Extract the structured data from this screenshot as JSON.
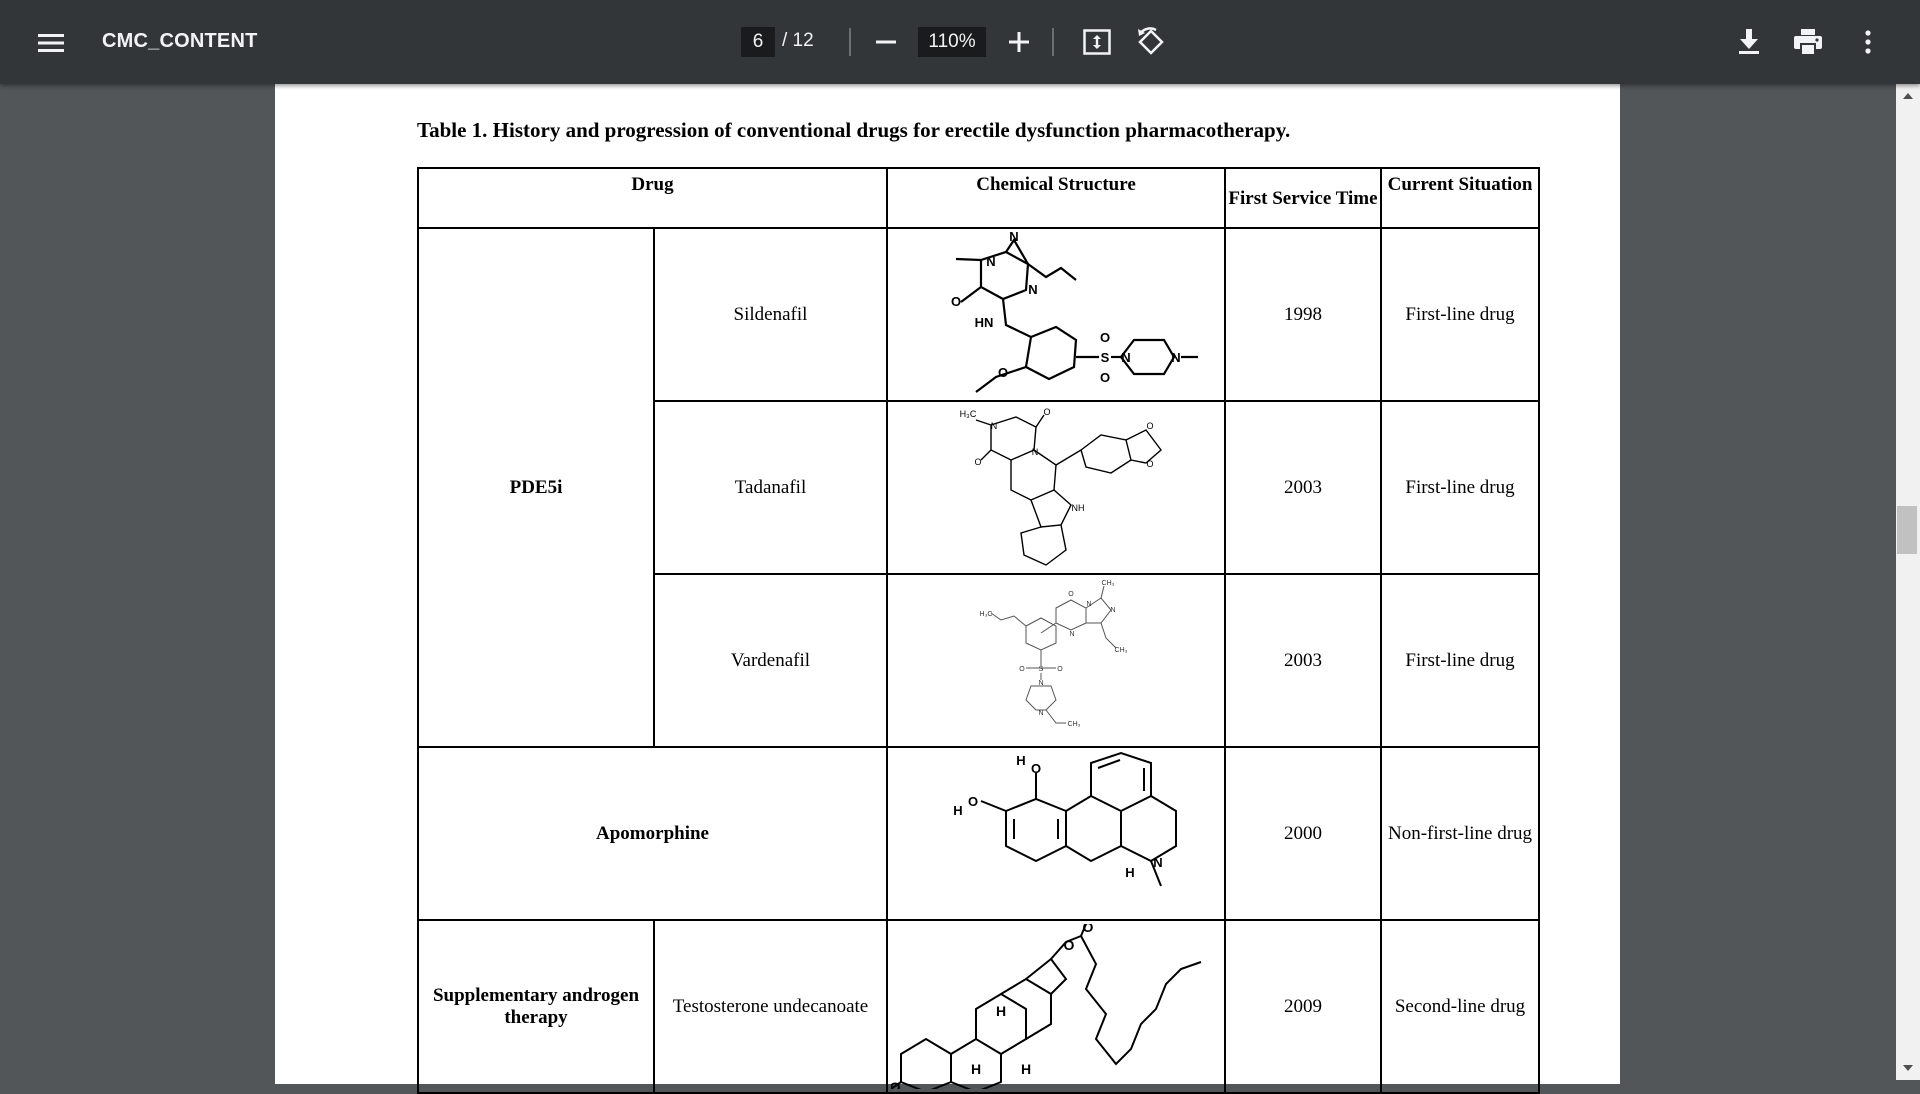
{
  "viewer": {
    "title": "CMC_CONTENT",
    "current_page": "6",
    "page_total": "/ 12",
    "zoom": "110%",
    "icons": {
      "menu": "hamburger-menu-icon",
      "zoom_out": "minus-icon",
      "zoom_in": "plus-icon",
      "fit": "fit-to-page-icon",
      "rotate": "rotate-counterclockwise-icon",
      "download": "download-icon",
      "print": "print-icon",
      "more": "more-vertical-icon"
    }
  },
  "document": {
    "caption": "Table 1. History and progression of conventional drugs for erectile dysfunction pharmacotherapy.",
    "table": {
      "headers": {
        "drug": "Drug",
        "structure": "Chemical Structure",
        "first_service_time": "First Service Time",
        "current_situation": "Current Situation"
      },
      "groups": {
        "pde5i": "PDE5i",
        "apomorphine": "Apomorphine",
        "androgen": "Supplementary androgen therapy"
      },
      "rows": [
        {
          "drug": "Sildenafil",
          "year": "1998",
          "status": "First-line drug"
        },
        {
          "drug": "Tadanafil",
          "year": "2003",
          "status": "First-line drug"
        },
        {
          "drug": "Vardenafil",
          "year": "2003",
          "status": "First-line drug"
        },
        {
          "drug": "",
          "year": "2000",
          "status": "Non-first-line drug"
        },
        {
          "drug": "Testosterone undecanoate",
          "year": "2009",
          "status": "Second-line drug"
        }
      ],
      "structure_labels": {
        "sildenafil": [
          "N",
          "N",
          "N",
          "O",
          "HN",
          "O",
          "O",
          "S",
          "O",
          "N",
          "N"
        ],
        "tadalafil": [
          "H₃C",
          "N",
          "O",
          "O",
          "N",
          "NH",
          "O",
          "O"
        ],
        "vardenafil": [
          "CH₃",
          "O",
          "N",
          "N",
          "N",
          "H₃C",
          "O",
          "S",
          "O",
          "N",
          "N",
          "CH₃",
          "CH₃"
        ],
        "apomorphine": [
          "H",
          "O",
          "H",
          "O",
          "H",
          "N"
        ],
        "testosterone": [
          "O",
          "O",
          "O",
          "H",
          "H",
          "H"
        ]
      }
    }
  }
}
